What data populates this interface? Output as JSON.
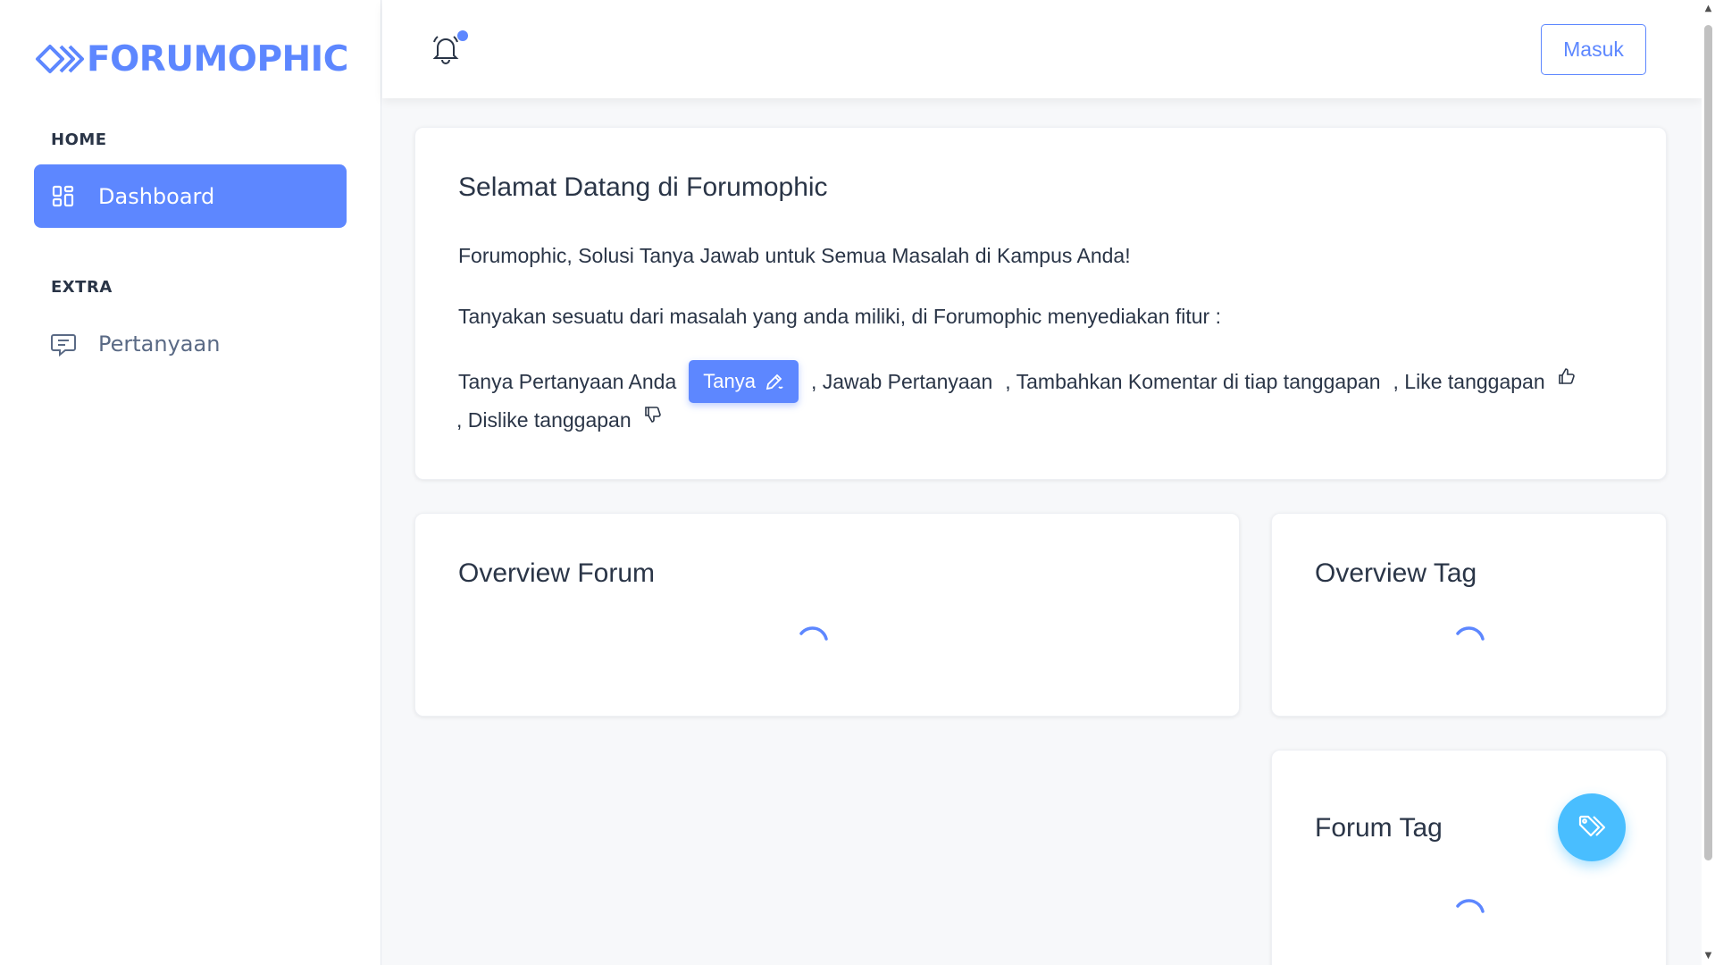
{
  "brand": {
    "name": "FORUMOPHIC",
    "color": "#5d87ff"
  },
  "sidebar": {
    "sections": [
      {
        "caption": "HOME",
        "items": [
          {
            "label": "Dashboard",
            "icon": "dashboard-grid-icon",
            "active": true
          }
        ]
      },
      {
        "caption": "EXTRA",
        "items": [
          {
            "label": "Pertanyaan",
            "icon": "message-question-icon",
            "active": false
          }
        ]
      }
    ]
  },
  "header": {
    "notification_icon": "bell-icon",
    "has_unread": true,
    "login_label": "Masuk"
  },
  "welcome": {
    "title": "Selamat Datang di Forumophic",
    "line1": "Forumophic, Solusi Tanya Jawab untuk Semua Masalah di Kampus Anda!",
    "line2": "Tanyakan sesuatu dari masalah yang anda miliki, di Forumophic menyediakan fitur :",
    "feature_ask": "Tanya Pertanyaan Anda",
    "ask_button": "Tanya",
    "feature_answer": ", Jawab Pertanyaan",
    "feature_comment": ", Tambahkan Komentar di tiap tanggapan",
    "feature_like": ", Like tanggapan",
    "feature_dislike": ", Dislike tanggapan"
  },
  "cards": {
    "overview_forum": {
      "title": "Overview Forum",
      "loading": true
    },
    "overview_tag": {
      "title": "Overview Tag",
      "loading": true
    },
    "forum_tag": {
      "title": "Forum Tag",
      "loading": true
    }
  },
  "fab": {
    "icon": "tags-icon",
    "color": "#49beff"
  }
}
